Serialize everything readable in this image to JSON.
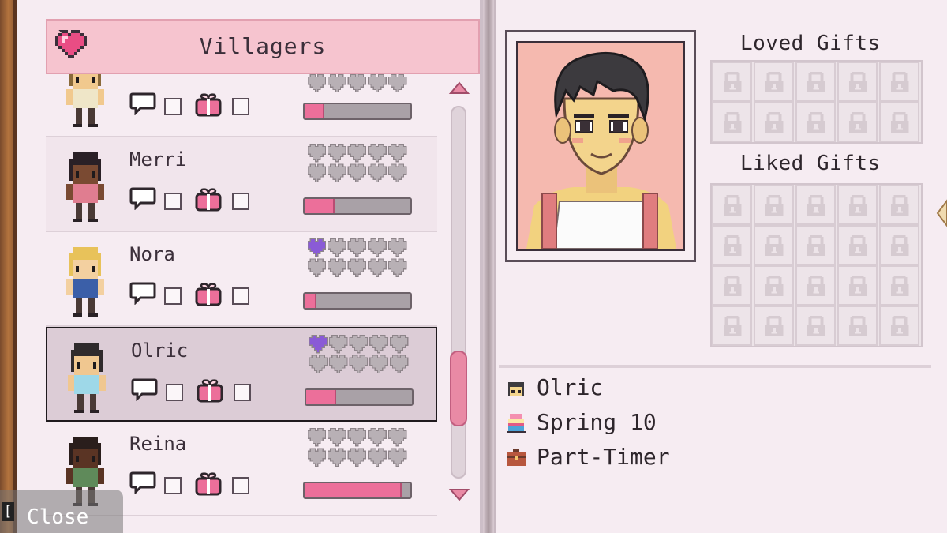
{
  "header": {
    "title": "Villagers",
    "icon": "heart-icon",
    "accent": "#f6c4cf"
  },
  "villagers": [
    {
      "name": "",
      "hearts_purple": 0,
      "hearts_rows": 1,
      "bar_fraction": 0.17,
      "selected": false
    },
    {
      "name": "Merri",
      "hearts_purple": 0,
      "hearts_rows": 2,
      "bar_fraction": 0.27,
      "selected": false
    },
    {
      "name": "Nora",
      "hearts_purple": 1,
      "hearts_rows": 2,
      "bar_fraction": 0.1,
      "selected": false
    },
    {
      "name": "Olric",
      "hearts_purple": 1,
      "hearts_rows": 2,
      "bar_fraction": 0.27,
      "selected": true
    },
    {
      "name": "Reina",
      "hearts_purple": 0,
      "hearts_rows": 2,
      "bar_fraction": 0.9,
      "selected": false
    }
  ],
  "close": {
    "key": "[",
    "label": "Close"
  },
  "detail": {
    "loved_title": "Loved Gifts",
    "liked_title": "Liked Gifts",
    "loved_slots": 10,
    "liked_slots": 20,
    "name": "Olric",
    "birthday": "Spring 10",
    "occupation": "Part-Timer"
  },
  "colors": {
    "bar_fill": "#ec6f9a",
    "heart_purple": "#8a5bd6",
    "heart_grey": "#b8b0b5"
  }
}
